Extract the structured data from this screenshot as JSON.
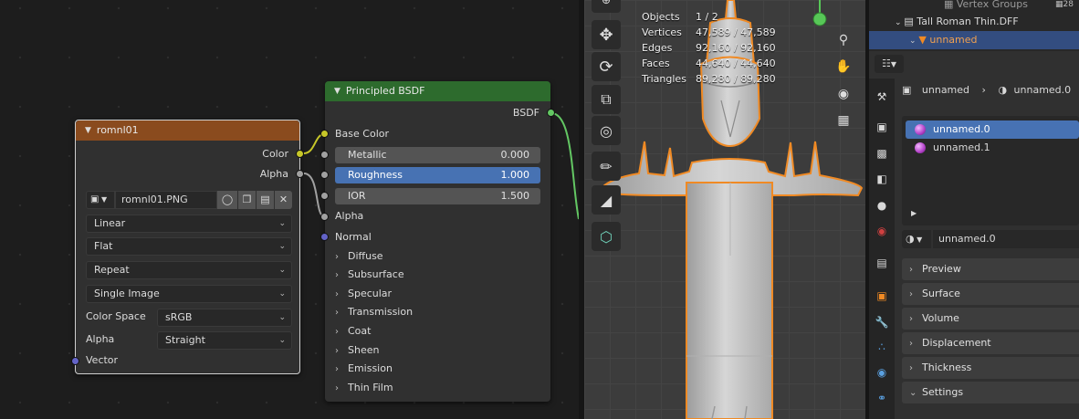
{
  "node_editor": {
    "image_node": {
      "title": "romnl01",
      "header_color": "#8a4b1e",
      "outputs": [
        "Color",
        "Alpha"
      ],
      "image_name": "romnl01.PNG",
      "interpolation": "Linear",
      "projection": "Flat",
      "extension": "Repeat",
      "source": "Single Image",
      "color_space_label": "Color Space",
      "color_space_value": "sRGB",
      "alpha_label": "Alpha",
      "alpha_value": "Straight",
      "input_vector": "Vector"
    },
    "bsdf_node": {
      "title": "Principled BSDF",
      "header_color": "#2d6b2d",
      "output": "BSDF",
      "base_color": "Base Color",
      "metallic_label": "Metallic",
      "metallic_value": "0.000",
      "roughness_label": "Roughness",
      "roughness_value": "1.000",
      "ior_label": "IOR",
      "ior_value": "1.500",
      "alpha": "Alpha",
      "normal": "Normal",
      "subpanels": [
        "Diffuse",
        "Subsurface",
        "Specular",
        "Transmission",
        "Coat",
        "Sheen",
        "Emission",
        "Thin Film"
      ]
    }
  },
  "viewport": {
    "stats": [
      {
        "label": "Objects",
        "value": "1 / 2"
      },
      {
        "label": "Vertices",
        "value": "47,589 / 47,589"
      },
      {
        "label": "Edges",
        "value": "92,160 / 92,160"
      },
      {
        "label": "Faces",
        "value": "44,640 / 44,640"
      },
      {
        "label": "Triangles",
        "value": "89,280 / 89,280"
      }
    ],
    "tools": [
      "move-icon",
      "rotate-icon",
      "scale-icon",
      "transform-icon",
      "annotate-icon",
      "measure-icon",
      "add-cube-icon"
    ],
    "nav": [
      "zoom-icon",
      "pan-hand-icon",
      "camera-icon",
      "grid-icon"
    ],
    "selection_color": "#f08a24"
  },
  "outliner": {
    "vertex_groups": "Vertex Groups",
    "vg_count": "28",
    "object_name": "Tall Roman Thin.DFF",
    "mesh_name": "unnamed"
  },
  "properties": {
    "breadcrumb_object": "unnamed",
    "breadcrumb_material": "unnamed.0",
    "material_slots": [
      "unnamed.0",
      "unnamed.1"
    ],
    "selected_material": "unnamed.0",
    "panels": [
      "Preview",
      "Surface",
      "Volume",
      "Displacement",
      "Thickness",
      "Settings"
    ],
    "accent_color": "#4772b3"
  }
}
